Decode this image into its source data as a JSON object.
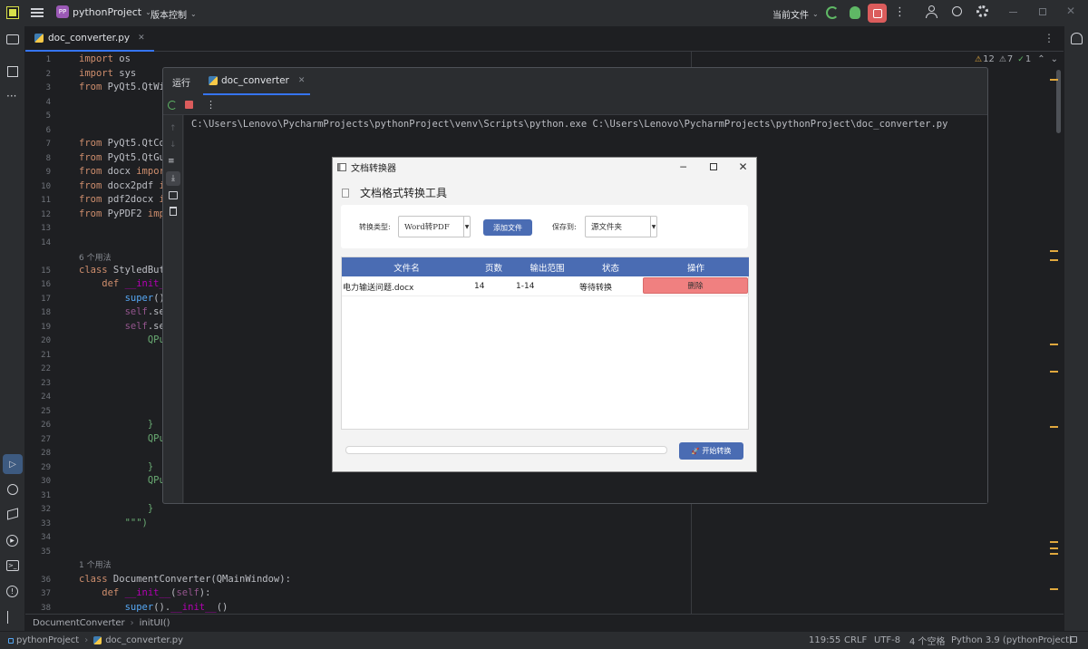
{
  "titlebar": {
    "project_badge": "PP",
    "project_name": "pythonProject",
    "vcs_label": "版本控制",
    "run_config": "当前文件"
  },
  "editor_tab": {
    "filename": "doc_converter.py"
  },
  "inspections": {
    "warnings": "12",
    "weak_warnings": "7",
    "ok": "1"
  },
  "code_lines": [
    {
      "n": "1",
      "parts": [
        [
          "kw",
          "import"
        ],
        [
          "cls",
          " os"
        ]
      ]
    },
    {
      "n": "2",
      "parts": [
        [
          "kw",
          "import"
        ],
        [
          "cls",
          " sys"
        ]
      ]
    },
    {
      "n": "3",
      "parts": [
        [
          "kw",
          "from"
        ],
        [
          "cls",
          " PyQt5.QtWid"
        ]
      ]
    },
    {
      "n": "4",
      "parts": []
    },
    {
      "n": "5",
      "parts": []
    },
    {
      "n": "6",
      "parts": []
    },
    {
      "n": "7",
      "parts": [
        [
          "kw",
          "from"
        ],
        [
          "cls",
          " PyQt5.QtCor"
        ]
      ]
    },
    {
      "n": "8",
      "parts": [
        [
          "kw",
          "from"
        ],
        [
          "cls",
          " PyQt5.QtGui"
        ]
      ]
    },
    {
      "n": "9",
      "parts": [
        [
          "kw",
          "from"
        ],
        [
          "cls",
          " docx "
        ],
        [
          "kw",
          "import"
        ]
      ]
    },
    {
      "n": "10",
      "parts": [
        [
          "kw",
          "from"
        ],
        [
          "cls",
          " docx2pdf "
        ],
        [
          "kw",
          "im"
        ]
      ]
    },
    {
      "n": "11",
      "parts": [
        [
          "kw",
          "from"
        ],
        [
          "cls",
          " pdf2docx "
        ],
        [
          "kw",
          "im"
        ]
      ]
    },
    {
      "n": "12",
      "parts": [
        [
          "kw",
          "from"
        ],
        [
          "cls",
          " PyPDF2 "
        ],
        [
          "kw",
          "impo"
        ]
      ]
    },
    {
      "n": "13",
      "parts": []
    },
    {
      "n": "14",
      "parts": []
    },
    {
      "n": "15",
      "parts": [
        [
          "kw",
          "class"
        ],
        [
          "cls",
          " StyledButt"
        ]
      ]
    },
    {
      "n": "16",
      "parts": [
        [
          "kw",
          "    def "
        ],
        [
          "dunder",
          "__init__"
        ]
      ]
    },
    {
      "n": "17",
      "parts": [
        [
          "cls",
          "        "
        ],
        [
          "fn",
          "super"
        ],
        [
          "cls",
          "()."
        ]
      ]
    },
    {
      "n": "18",
      "parts": [
        [
          "self",
          "        self"
        ],
        [
          "cls",
          ".set"
        ]
      ]
    },
    {
      "n": "19",
      "parts": [
        [
          "self",
          "        self"
        ],
        [
          "cls",
          ".set"
        ]
      ]
    },
    {
      "n": "20",
      "parts": [
        [
          "str",
          "            QPus"
        ]
      ]
    },
    {
      "n": "21",
      "parts": [
        [
          "str",
          "                "
        ]
      ]
    },
    {
      "n": "22",
      "parts": [
        [
          "str",
          "                "
        ]
      ]
    },
    {
      "n": "23",
      "parts": [
        [
          "str",
          "                "
        ]
      ]
    },
    {
      "n": "24",
      "parts": [
        [
          "str",
          "                "
        ]
      ]
    },
    {
      "n": "25",
      "parts": []
    },
    {
      "n": "26",
      "parts": [
        [
          "str",
          "            }"
        ]
      ]
    },
    {
      "n": "27",
      "parts": [
        [
          "str",
          "            QPus"
        ]
      ]
    },
    {
      "n": "28",
      "parts": [
        [
          "str",
          "                "
        ]
      ]
    },
    {
      "n": "29",
      "parts": [
        [
          "str",
          "            }"
        ]
      ]
    },
    {
      "n": "30",
      "parts": [
        [
          "str",
          "            QPus"
        ]
      ]
    },
    {
      "n": "31",
      "parts": [
        [
          "str",
          "                "
        ]
      ]
    },
    {
      "n": "32",
      "parts": [
        [
          "str",
          "            }"
        ]
      ]
    },
    {
      "n": "33",
      "parts": [
        [
          "str",
          "        \"\"\")"
        ]
      ]
    },
    {
      "n": "34",
      "parts": []
    },
    {
      "n": "35",
      "parts": []
    },
    {
      "n": "36",
      "parts": [
        [
          "kw",
          "class"
        ],
        [
          "cls",
          " DocumentConverter(QMainWindow):"
        ]
      ]
    },
    {
      "n": "37",
      "parts": [
        [
          "kw",
          "    def "
        ],
        [
          "dunder",
          "__init__"
        ],
        [
          "cls",
          "("
        ],
        [
          "self",
          "self"
        ],
        [
          "cls",
          "):"
        ]
      ]
    },
    {
      "n": "38",
      "parts": [
        [
          "cls",
          "        "
        ],
        [
          "fn",
          "super"
        ],
        [
          "cls",
          "()."
        ],
        [
          "dunder",
          "__init__"
        ],
        [
          "cls",
          "()"
        ]
      ]
    }
  ],
  "usage_hints": {
    "class_styled": "6 个用法",
    "class_converter": "1 个用法"
  },
  "run_panel": {
    "title": "运行",
    "tab": "doc_converter",
    "console_line": "C:\\Users\\Lenovo\\PycharmProjects\\pythonProject\\venv\\Scripts\\python.exe C:\\Users\\Lenovo\\PycharmProjects\\pythonProject\\doc_converter.py"
  },
  "dialog": {
    "window_title": "文档转换器",
    "heading": "文档格式转换工具",
    "convert_type_label": "转换类型:",
    "convert_type_value": "Word转PDF",
    "add_file_button": "添加文件",
    "save_to_label": "保存到:",
    "save_to_value": "源文件夹",
    "table_headers": [
      "文件名",
      "页数",
      "输出范围",
      "状态",
      "操作"
    ],
    "rows": [
      {
        "filename": "电力输送问题.docx",
        "pages": "14",
        "range": "1-14",
        "status": "等待转换",
        "action": "删除"
      }
    ],
    "progress": 0,
    "start_button": "开始转换"
  },
  "breadcrumb": {
    "class": "DocumentConverter",
    "method": "initUI()"
  },
  "statusbar": {
    "project": "pythonProject",
    "file": "doc_converter.py",
    "position": "119:55",
    "line_sep": "CRLF",
    "encoding": "UTF-8",
    "indent": "4 个空格",
    "interpreter": "Python 3.9 (pythonProject)"
  },
  "colors": {
    "accent_blue": "#4a6cb3",
    "delete_red": "#f08080",
    "ide_bg": "#1e1f22",
    "ide_panel": "#2b2d30"
  }
}
